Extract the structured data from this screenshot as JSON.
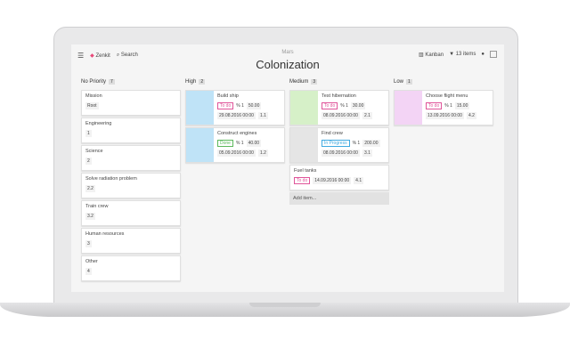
{
  "header": {
    "app": "Zenkit",
    "search": "Search",
    "workspace": "Mars",
    "title": "Colonization",
    "view": "Kanban",
    "items": "13 items"
  },
  "columns": [
    {
      "name": "No Priority",
      "count": "7",
      "cards": [
        {
          "name": "Mission",
          "value": "Root"
        },
        {
          "name": "Engineering",
          "value": "1"
        },
        {
          "name": "Science",
          "value": "2"
        },
        {
          "name": "Solve radiation problem",
          "value": "2.2"
        },
        {
          "name": "Train crew",
          "value": "3.2"
        },
        {
          "name": "Human resources",
          "value": "3"
        },
        {
          "name": "Other",
          "value": "4"
        }
      ]
    },
    {
      "name": "High",
      "count": "2",
      "cards": [
        {
          "name": "Build ship",
          "status": "To do",
          "pct": "1",
          "amount": "50.00",
          "date": "29.08.2016 00:00",
          "id": "1.1",
          "img": "#bfe3f7"
        },
        {
          "name": "Construct engines",
          "status": "Done",
          "pct": "1",
          "amount": "40.00",
          "date": "05.09.2016 00:00",
          "id": "1.2",
          "img": "#bfe3f7"
        }
      ]
    },
    {
      "name": "Medium",
      "count": "3",
      "cards": [
        {
          "name": "Test hibernation",
          "status": "To do",
          "pct": "1",
          "amount": "30.00",
          "date": "08.09.2016 00:00",
          "id": "2.1",
          "img": "#d6f0c8"
        },
        {
          "name": "Find crew",
          "status": "In Progress",
          "pct": "1",
          "amount": "200.00",
          "date": "08.09.2016 00:00",
          "id": "3.1",
          "img": "#e5e5e5"
        },
        {
          "name": "Fuel tanks",
          "status": "To do",
          "date": "14.09.2016 00:00",
          "id": "4.1"
        }
      ],
      "add": "Add item..."
    },
    {
      "name": "Low",
      "count": "1",
      "cards": [
        {
          "name": "Choose flight menu",
          "status": "To do",
          "pct": "1",
          "amount": "15.00",
          "date": "13.09.2016 00:00",
          "id": "4.2",
          "img": "#f3d4f5"
        }
      ]
    }
  ],
  "status_colors": {
    "To do": "#e0559a",
    "Done": "#5cb85c",
    "In Progress": "#3fa9e0"
  }
}
